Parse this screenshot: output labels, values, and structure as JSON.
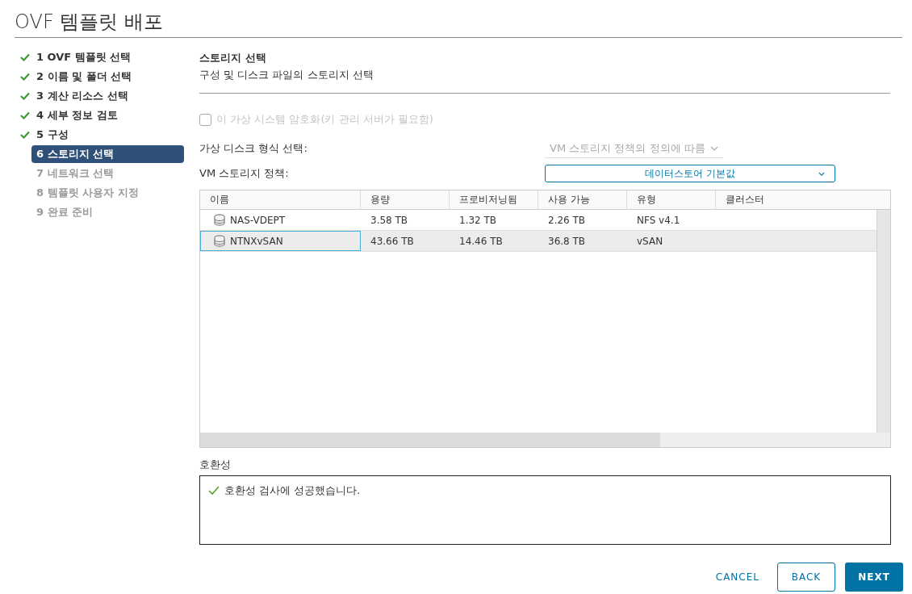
{
  "window": {
    "title": "OVF 템플릿 배포"
  },
  "steps": [
    {
      "label": "1 OVF 템플릿 선택",
      "completed": true,
      "selected": false
    },
    {
      "label": "2 이름 및 폴더 선택",
      "completed": true,
      "selected": false
    },
    {
      "label": "3 계산 리소스 선택",
      "completed": true,
      "selected": false
    },
    {
      "label": "4 세부 정보 검토",
      "completed": true,
      "selected": false
    },
    {
      "label": "5 구성",
      "completed": true,
      "selected": false
    },
    {
      "label": "6 스토리지 선택",
      "completed": false,
      "selected": true
    },
    {
      "label": "7 네트워크 선택",
      "completed": false,
      "selected": false
    },
    {
      "label": "8 템플릿 사용자 지정",
      "completed": false,
      "selected": false
    },
    {
      "label": "9 완료 준비",
      "completed": false,
      "selected": false
    }
  ],
  "header": {
    "title": "스토리지 선택",
    "subtitle": "구성 및 디스크 파일의 스토리지 선택"
  },
  "encrypt_checkbox": {
    "label": "이 가상 시스템 암호화(키 관리 서버가 필요함)",
    "checked": false,
    "disabled": true
  },
  "disk_format": {
    "label": "가상 디스크 형식 선택:",
    "value": "VM 스토리지 정책의 정의에 따름",
    "disabled": true
  },
  "storage_policy": {
    "label": "VM 스토리지 정책:",
    "value": "데이터스토어 기본값",
    "disabled": false
  },
  "table": {
    "columns": [
      "이름",
      "용량",
      "프로비저닝됨",
      "사용 가능",
      "유형",
      "클러스터"
    ],
    "rows": [
      {
        "cells": [
          "NAS-VDEPT",
          "3.58 TB",
          "1.32 TB",
          "2.26 TB",
          "NFS v4.1"
        ],
        "selected": false
      },
      {
        "cells": [
          "NTNXvSAN",
          "43.66 TB",
          "14.46 TB",
          "36.8 TB",
          "vSAN"
        ],
        "selected": true
      }
    ]
  },
  "compatibility": {
    "label": "호환성",
    "message": "호환성 검사에 성공했습니다."
  },
  "buttons": [
    {
      "label": "CANCEL",
      "kind": "link"
    },
    {
      "label": "BACK",
      "kind": "outline"
    },
    {
      "label": "NEXT",
      "kind": "primary"
    }
  ]
}
